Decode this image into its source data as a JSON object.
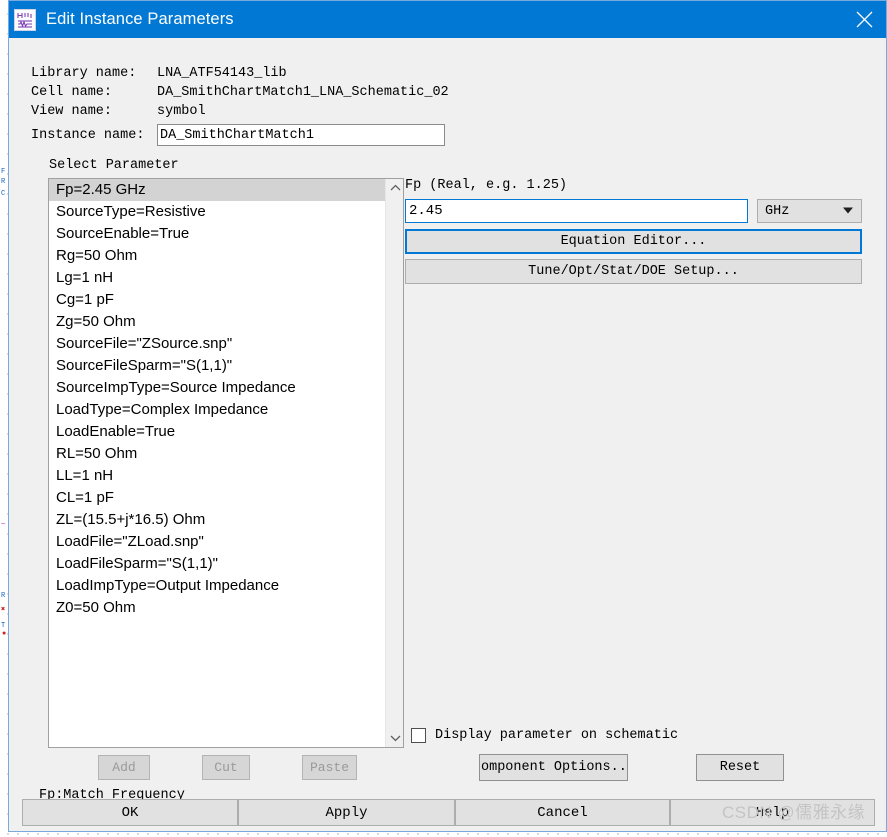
{
  "window": {
    "title": "Edit Instance Parameters",
    "icon": "schematic-component-icon",
    "close_icon": "close-icon",
    "titlebar_color": "#0078d4"
  },
  "info": {
    "library_label": "Library name:",
    "library_value": "LNA_ATF54143_lib",
    "cell_label": "Cell name:",
    "cell_value": "DA_SmithChartMatch1_LNA_Schematic_02",
    "view_label": "View name:",
    "view_value": "symbol",
    "instance_label": "Instance name:",
    "instance_value": "DA_SmithChartMatch1"
  },
  "select_parameter": {
    "group_label": "Select Parameter",
    "selected_index": 0,
    "items": [
      "Fp=2.45 GHz",
      "SourceType=Resistive",
      "SourceEnable=True",
      "Rg=50 Ohm",
      "Lg=1 nH",
      "Cg=1 pF",
      "Zg=50 Ohm",
      "SourceFile=\"ZSource.snp\"",
      "SourceFileSparm=\"S(1,1)\"",
      "SourceImpType=Source Impedance",
      "LoadType=Complex Impedance",
      "LoadEnable=True",
      "RL=50 Ohm",
      "LL=1 nH",
      "CL=1 pF",
      "ZL=(15.5+j*16.5) Ohm",
      "LoadFile=\"ZLoad.snp\"",
      "LoadFileSparm=\"S(1,1)\"",
      "LoadImpType=Output Impedance",
      "Z0=50 Ohm"
    ],
    "scroll_up_icon": "chevron-up-icon",
    "scroll_down_icon": "chevron-down-icon"
  },
  "list_buttons": {
    "add": "Add",
    "cut": "Cut",
    "paste": "Paste"
  },
  "hint": "Fp:Match Frequency",
  "editor": {
    "param_type_label": "Fp (Real, e.g. 1.25)",
    "value": "2.45",
    "unit": "GHz",
    "unit_caret_icon": "caret-down-icon",
    "equation_editor_label": "Equation Editor...",
    "tune_setup_label": "Tune/Opt/Stat/DOE Setup..."
  },
  "options": {
    "display_parameter_label": "Display parameter on schematic",
    "display_parameter_checked": false,
    "component_options_label": "omponent Options..",
    "reset_label": "Reset"
  },
  "actions": {
    "ok": "OK",
    "apply": "Apply",
    "cancel": "Cancel",
    "help": "Help"
  },
  "watermark": "CSDN @儒雅永缘"
}
